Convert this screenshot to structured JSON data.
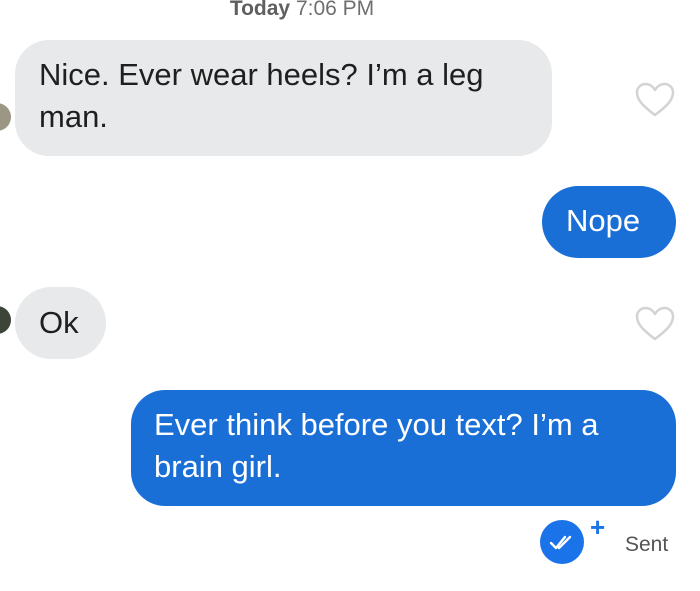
{
  "header": {
    "day": "Today",
    "time": "7:06 PM"
  },
  "messages": [
    {
      "direction": "incoming",
      "text": "Nice. Ever wear heels?  I’m a leg man.",
      "liked": false
    },
    {
      "direction": "outgoing",
      "text": "Nope"
    },
    {
      "direction": "incoming",
      "text": "Ok",
      "liked": false
    },
    {
      "direction": "outgoing",
      "text": "Ever think before you text?  I’m a brain girl."
    }
  ],
  "receipt": {
    "status": "Sent",
    "plus": "+",
    "icon": "double-check-icon"
  },
  "colors": {
    "incoming_bubble": "#e7e9ea",
    "outgoing_bubble": "#1a6fd6",
    "accent": "#1a73e8",
    "heart_outline": "#d3d3d3"
  }
}
